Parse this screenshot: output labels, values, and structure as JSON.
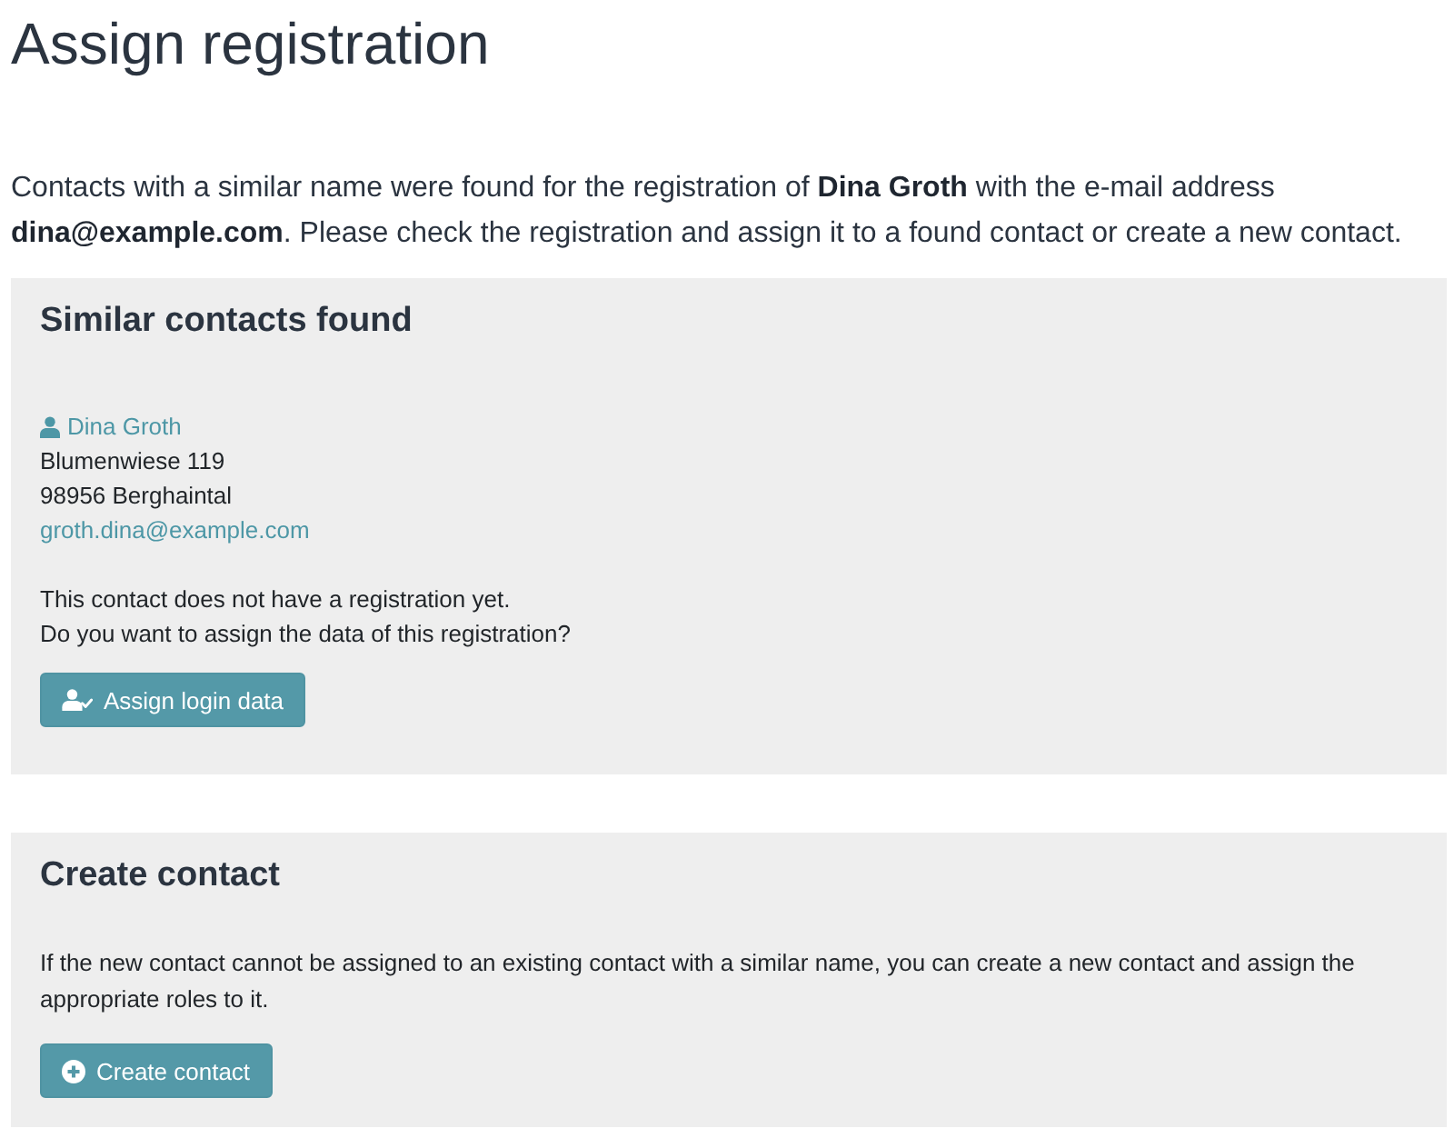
{
  "page": {
    "title": "Assign registration",
    "intro": "Contacts with a similar name were found for the registration of **Dina Groth** with the e-mail address **dina@example.com**. Please check the registration and assign it to a found contact or create a new contact."
  },
  "similar_contacts": {
    "title": "Similar contacts found",
    "contacts": [
      {
        "name": "Dina Groth",
        "address_lines": [
          "Blumenwiese 119",
          "98956 Berghaintal"
        ],
        "email": "groth.dina@example.com",
        "note_lines": [
          "This contact does not have a registration yet.",
          "Do you want to assign the data of this registration?"
        ],
        "button": "Assign login data"
      }
    ]
  },
  "create_contact": {
    "title": "Create contact",
    "text": "If the new contact cannot be assigned to an existing contact with a similar name, you can create a new contact and assign the appropriate roles to it.",
    "button": "Create contact"
  }
}
